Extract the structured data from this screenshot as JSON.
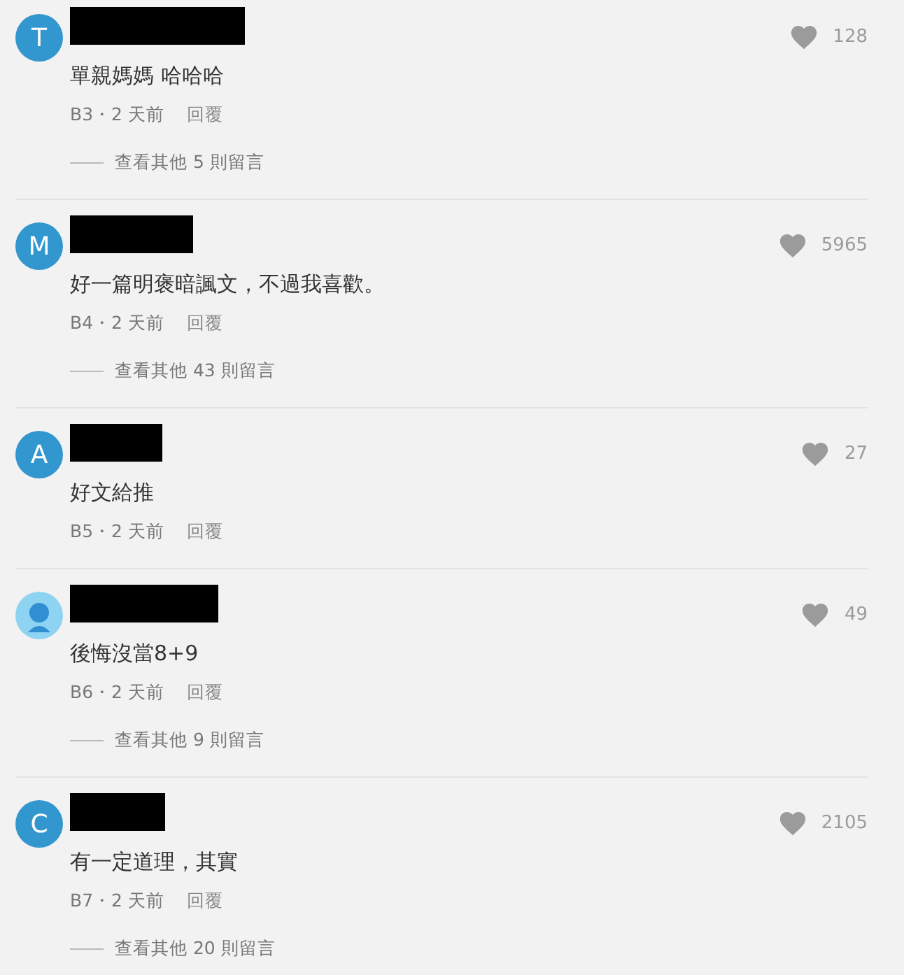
{
  "comments": [
    {
      "avatar": {
        "kind": "letter",
        "letter": "T"
      },
      "likes": "128",
      "text": "單親媽媽 哈哈哈",
      "meta": "B3・2 天前",
      "reply": "回覆",
      "more_replies": "查看其他 5 則留言"
    },
    {
      "avatar": {
        "kind": "letter",
        "letter": "M"
      },
      "likes": "5965",
      "text": "好一篇明褒暗諷文，不過我喜歡。",
      "meta": "B4・2 天前",
      "reply": "回覆",
      "more_replies": "查看其他 43 則留言"
    },
    {
      "avatar": {
        "kind": "letter",
        "letter": "A"
      },
      "likes": "27",
      "text": "好文給推",
      "meta": "B5・2 天前",
      "reply": "回覆"
    },
    {
      "avatar": {
        "kind": "person"
      },
      "likes": "49",
      "text": "後悔沒當8+9",
      "meta": "B6・2 天前",
      "reply": "回覆",
      "more_replies": "查看其他 9 則留言"
    },
    {
      "avatar": {
        "kind": "letter",
        "letter": "C"
      },
      "likes": "2105",
      "text": "有一定道理，其實",
      "meta": "B7・2 天前",
      "reply": "回覆",
      "more_replies": "查看其他 20 則留言"
    }
  ]
}
